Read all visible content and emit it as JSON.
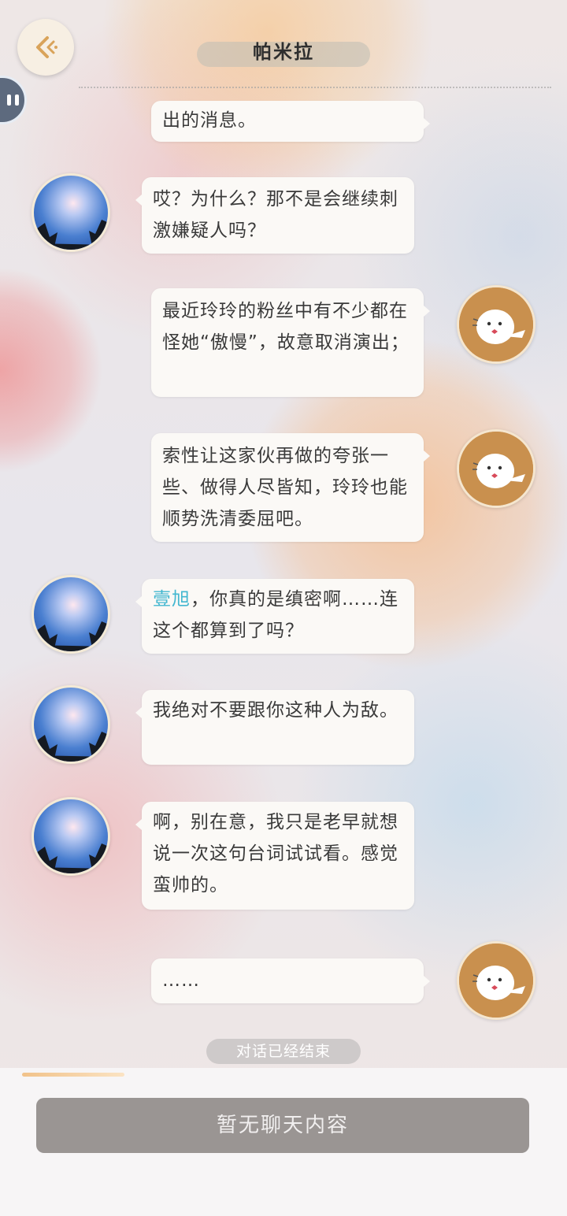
{
  "header": {
    "title": "帕米拉"
  },
  "messages": [
    {
      "side": "right",
      "text": "出的消息。"
    },
    {
      "side": "left",
      "text": "哎？为什么？那不是会继续刺激嫌疑人吗？"
    },
    {
      "side": "right",
      "text": "最近玲玲的粉丝中有不少都在怪她“傲慢”，故意取消演出；"
    },
    {
      "side": "right",
      "text": "索性让这家伙再做的夸张一些、做得人尽皆知，玲玲也能顺势洗清委屈吧。"
    },
    {
      "side": "left",
      "highlight": "壹旭",
      "text": "，你真的是缜密啊……连这个都算到了吗？"
    },
    {
      "side": "left",
      "text": "我绝对不要跟你这种人为敌。"
    },
    {
      "side": "left",
      "text": "啊，别在意，我只是老早就想说一次这句台词试试看。感觉蛮帅的。"
    },
    {
      "side": "right",
      "text": "……"
    }
  ],
  "status": {
    "ended": "对话已经结束"
  },
  "footer": {
    "button_label": "暂无聊天内容"
  },
  "colors": {
    "highlight_name": "#43b7d0",
    "bubble": "#fbf9f6",
    "footer_button": "#9a9593",
    "player_avatar": "#c9904e"
  },
  "icons": {
    "back": "back-arrow-icon",
    "pause": "pause-icon",
    "player_avatar": "white-bird-icon",
    "npc_avatar": "night-sky-photo"
  }
}
